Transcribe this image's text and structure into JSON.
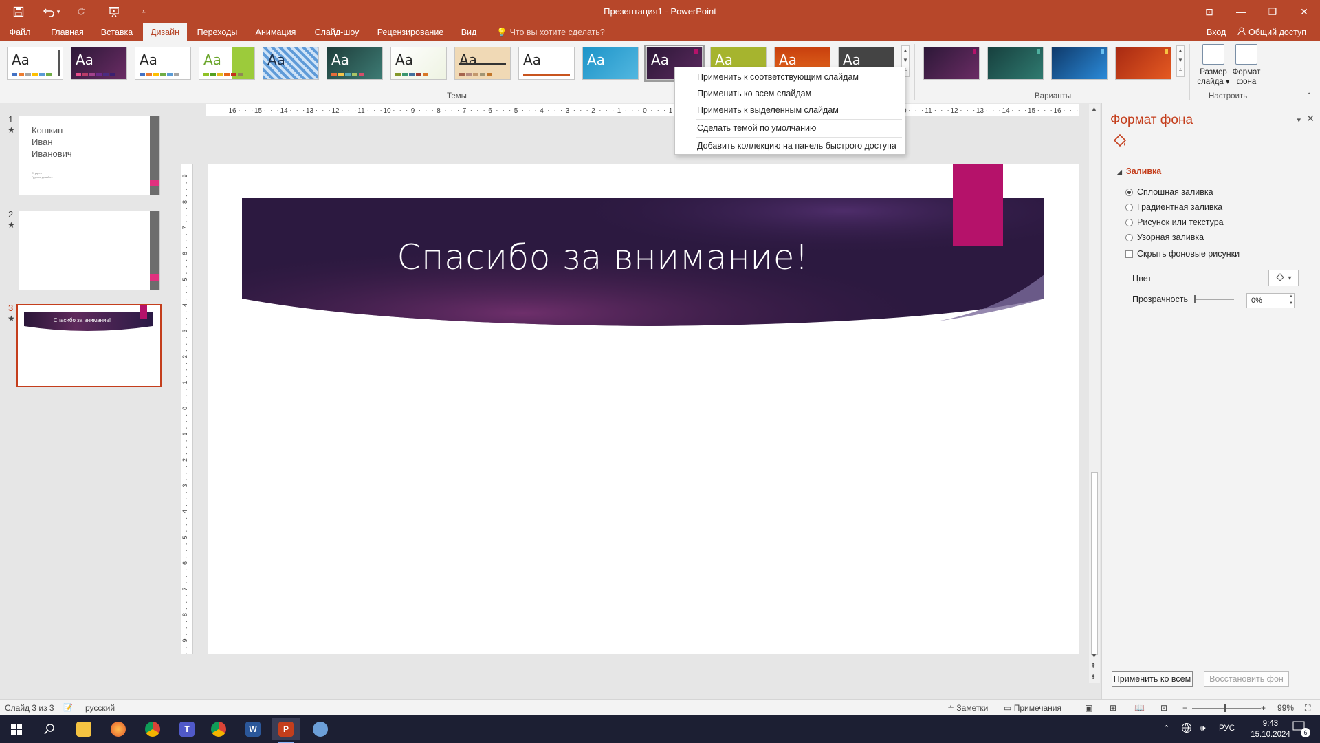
{
  "window": {
    "title": "Презентация1 - PowerPoint",
    "minimize": "—",
    "restore": "❐",
    "close": "✕",
    "ribbon_display": "⊡"
  },
  "quick_access": [
    "save-icon",
    "undo-icon",
    "redo-icon",
    "start-from-beginning-icon",
    "customize-icon"
  ],
  "tabs": [
    "Файл",
    "Главная",
    "Вставка",
    "Дизайн",
    "Переходы",
    "Анимация",
    "Слайд-шоу",
    "Рецензирование",
    "Вид"
  ],
  "active_tab": "Дизайн",
  "tell_me": "Что вы хотите сделать?",
  "sign_in": "Вход",
  "share": "Общий доступ",
  "ribbon": {
    "themes_label": "Темы",
    "variants_label": "Варианты",
    "customize_label": "Настроить",
    "theme_sample": "Aa",
    "slide_size": "Размер слайда",
    "format_background": "Формат фона"
  },
  "theme_colors": [
    "#ffffff",
    "#4a2245",
    "#ffffff",
    "#ffffff",
    "#4f86c6",
    "#2b5a56",
    "#ffffff",
    "#f0d9b5",
    "#ffffff",
    "#1e94c8",
    "#3b1f4f",
    "#a6b42e",
    "#c8400e",
    "#444444"
  ],
  "context_menu": [
    "Применить к соответствующим слайдам",
    "Применить ко всем слайдам",
    "Применить к выделенным слайдам",
    "Сделать темой по умолчанию",
    "Добавить коллекцию на панель быстрого доступа"
  ],
  "thumbnails": [
    {
      "number": "1",
      "star": "★",
      "text": "Кошкин\nИван\nИванович",
      "subtext_1": "Студент",
      "subtext_2": "Группа, дизайн..."
    },
    {
      "number": "2",
      "star": "★"
    },
    {
      "number": "3",
      "star": "★",
      "text": "Спасибо за внимание!"
    }
  ],
  "slide": {
    "title": "Спасибо за внимание!"
  },
  "ruler": {
    "h_ticks": [
      "16",
      "15",
      "14",
      "13",
      "12",
      "11",
      "10",
      "9",
      "8",
      "7",
      "6",
      "5",
      "4",
      "3",
      "2",
      "1",
      "0",
      "1",
      "2",
      "3",
      "4",
      "5",
      "6",
      "7",
      "8",
      "9",
      "10",
      "11",
      "12",
      "13",
      "14",
      "15",
      "16"
    ],
    "v_ticks": [
      "9",
      "8",
      "7",
      "6",
      "5",
      "4",
      "3",
      "2",
      "1",
      "0",
      "1",
      "2",
      "3",
      "4",
      "5",
      "6",
      "7",
      "8",
      "9"
    ]
  },
  "format_pane": {
    "title": "Формат фона",
    "section": "Заливка",
    "options": [
      "Сплошная заливка",
      "Градиентная заливка",
      "Рисунок или текстура",
      "Узорная заливка"
    ],
    "selected_option": "Сплошная заливка",
    "hide_bg": "Скрыть фоновые рисунки",
    "color_label": "Цвет",
    "transparency_label": "Прозрачность",
    "transparency_value": "0%",
    "apply_all": "Применить ко всем",
    "reset": "Восстановить фон"
  },
  "status": {
    "slide_info": "Слайд 3 из 3",
    "language": "русский",
    "notes": "Заметки",
    "comments": "Примечания",
    "zoom": "99%",
    "zoom_out": "−",
    "zoom_in": "+"
  },
  "taskbar": {
    "lang": "РУС",
    "time": "9:43",
    "date": "15.10.2024",
    "notifications": "6",
    "apps": [
      "start-icon",
      "search-icon",
      "file-explorer-icon",
      "firefox-icon",
      "chrome-icon",
      "teams-icon",
      "chrome-icon",
      "word-icon",
      "powerpoint-icon",
      "paint-icon"
    ]
  },
  "colors": {
    "brand": "#b7472a",
    "accent": "#c43e1c",
    "slide_banner": "#3b1f4f",
    "slide_tab": "#b5126a"
  }
}
